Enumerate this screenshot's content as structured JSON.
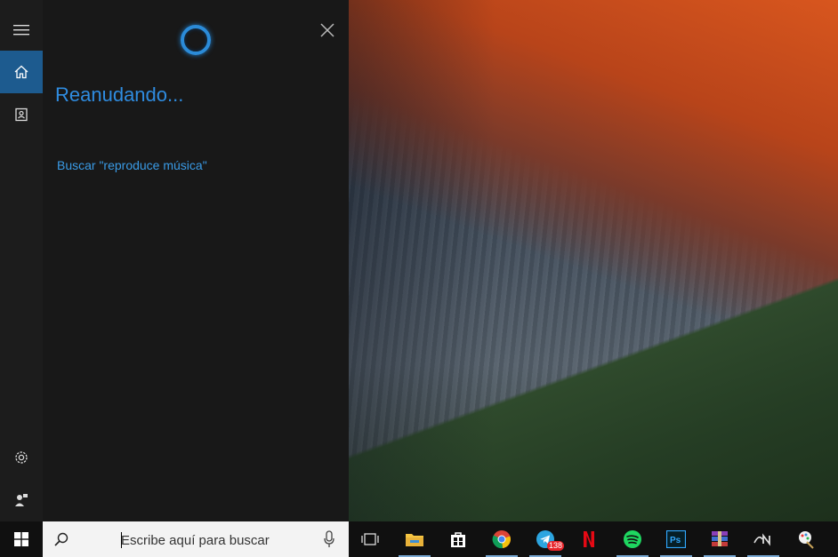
{
  "cortana": {
    "status_title": "Reanudando...",
    "search_suggestion": "Buscar \"reproduce música\""
  },
  "rail": {
    "items": [
      {
        "name": "menu",
        "icon": "hamburger-icon"
      },
      {
        "name": "home",
        "icon": "home-icon",
        "active": true
      },
      {
        "name": "notebook",
        "icon": "notebook-icon"
      },
      {
        "name": "settings",
        "icon": "gear-icon"
      },
      {
        "name": "feedback",
        "icon": "feedback-icon"
      }
    ]
  },
  "taskbar": {
    "search_placeholder": "Escribe aquí para buscar",
    "telegram_badge": "138",
    "apps": [
      "task-view",
      "file-explorer",
      "store",
      "chrome",
      "telegram",
      "netflix",
      "spotify",
      "photoshop",
      "winrar",
      "app-n",
      "app-last"
    ]
  },
  "colors": {
    "accent": "#1d5b8f",
    "cortana_blue": "#2f8ce0"
  }
}
